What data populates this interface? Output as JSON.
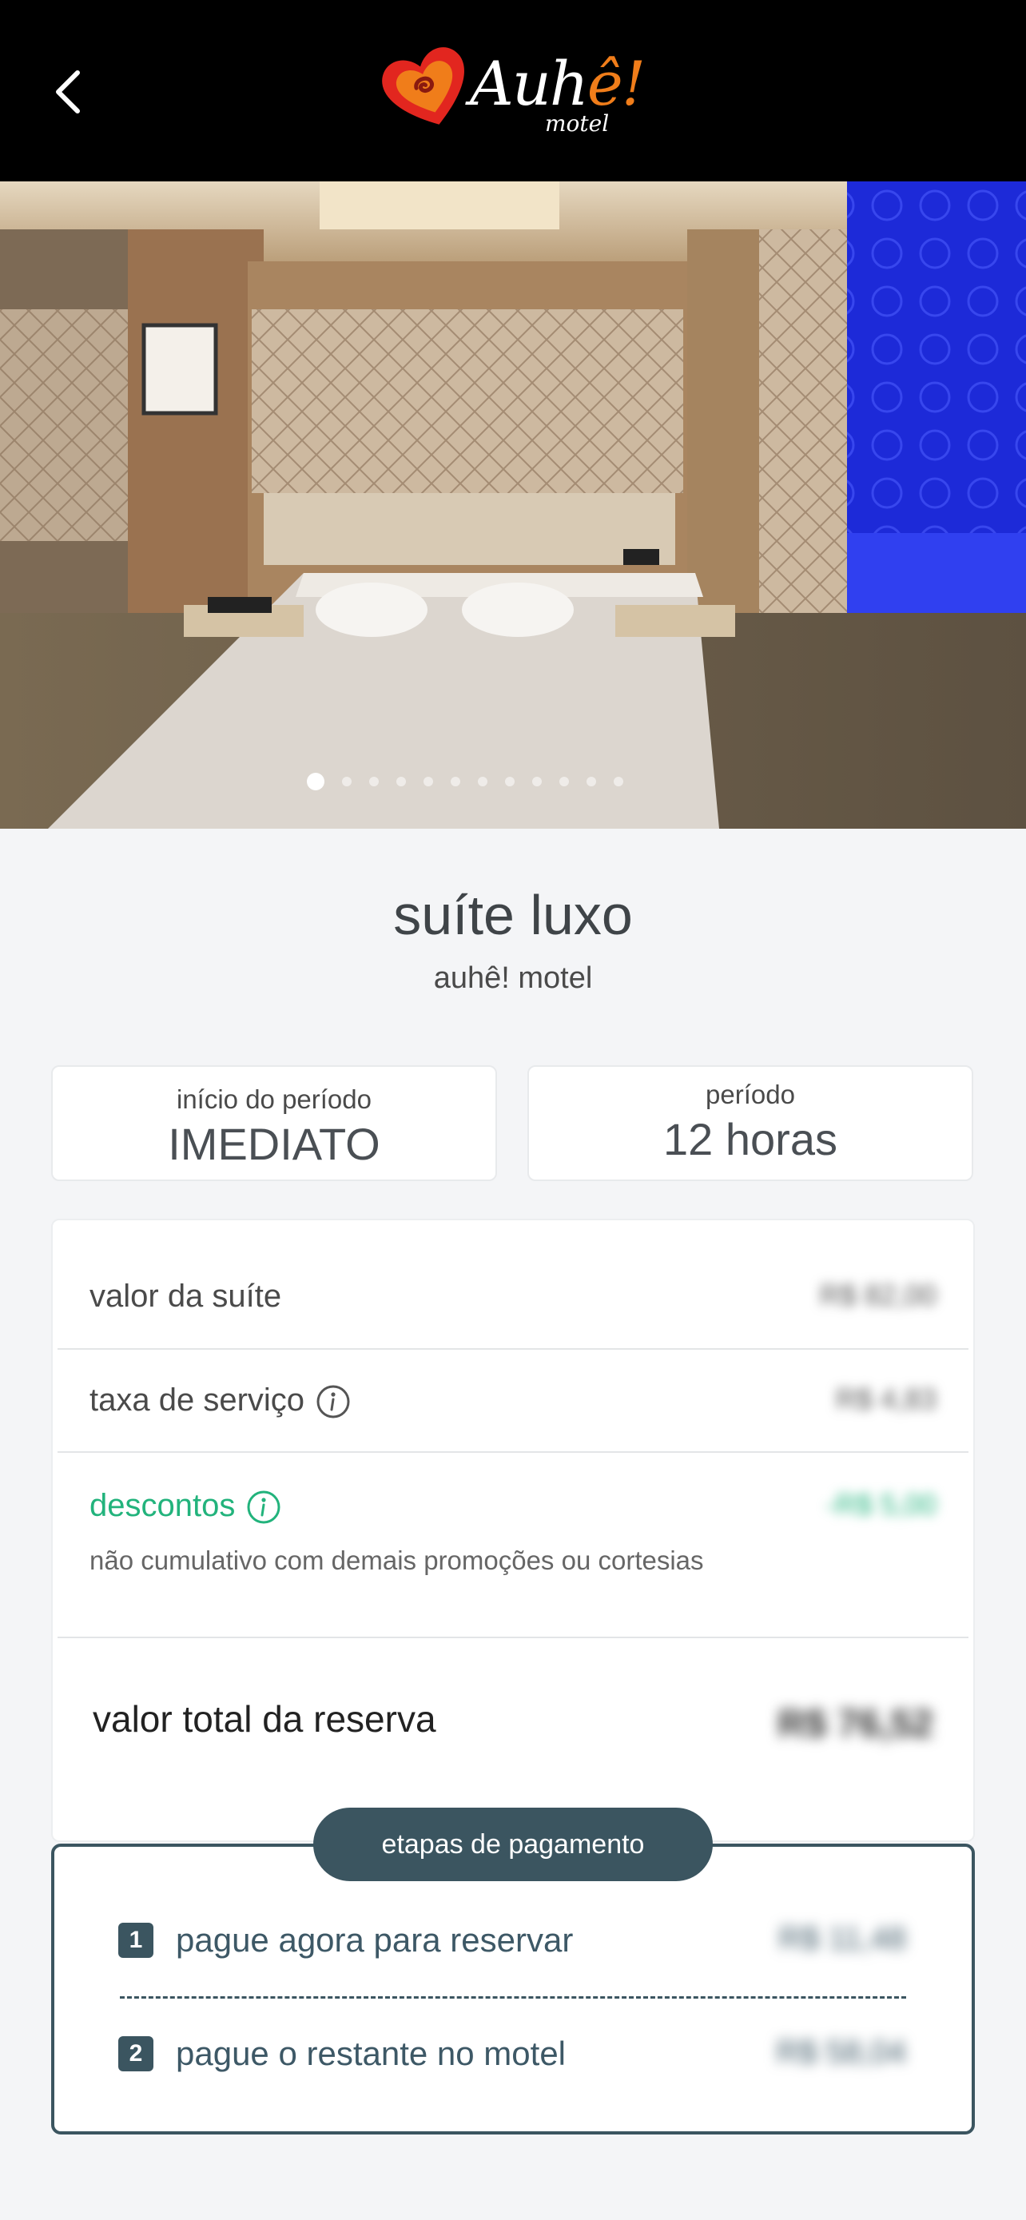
{
  "header": {
    "logo_text_main": "Auh",
    "logo_text_accent": "ê!",
    "logo_sub": "motel"
  },
  "gallery": {
    "dot_count": 12,
    "active_index": 0
  },
  "suite": {
    "title": "suíte luxo",
    "motel": "auhê! motel"
  },
  "period_start": {
    "label": "início do período",
    "value": "IMEDIATO"
  },
  "period": {
    "label": "período",
    "value": "12 horas"
  },
  "summary": {
    "suite_value_label": "valor da suíte",
    "suite_value": "R$ 82,00",
    "service_fee_label": "taxa de serviço",
    "service_fee": "R$ 4,83",
    "discount_label": "descontos",
    "discount_value": "-R$ 5,00",
    "discount_note": "não cumulativo com demais promoções ou cortesias",
    "total_label": "valor total da reserva",
    "total_value": "R$ 76,52"
  },
  "payment": {
    "title": "etapas de pagamento",
    "step1_num": "1",
    "step1_label": "pague agora para reservar",
    "step1_value": "R$ 11,48",
    "step2_num": "2",
    "step2_label": "pague o restante no motel",
    "step2_value": "R$ 58,04"
  },
  "colors": {
    "accent_green": "#22b37c",
    "payment_dark": "#3b5560",
    "logo_orange": "#f07d1a",
    "logo_red": "#e2261f"
  }
}
